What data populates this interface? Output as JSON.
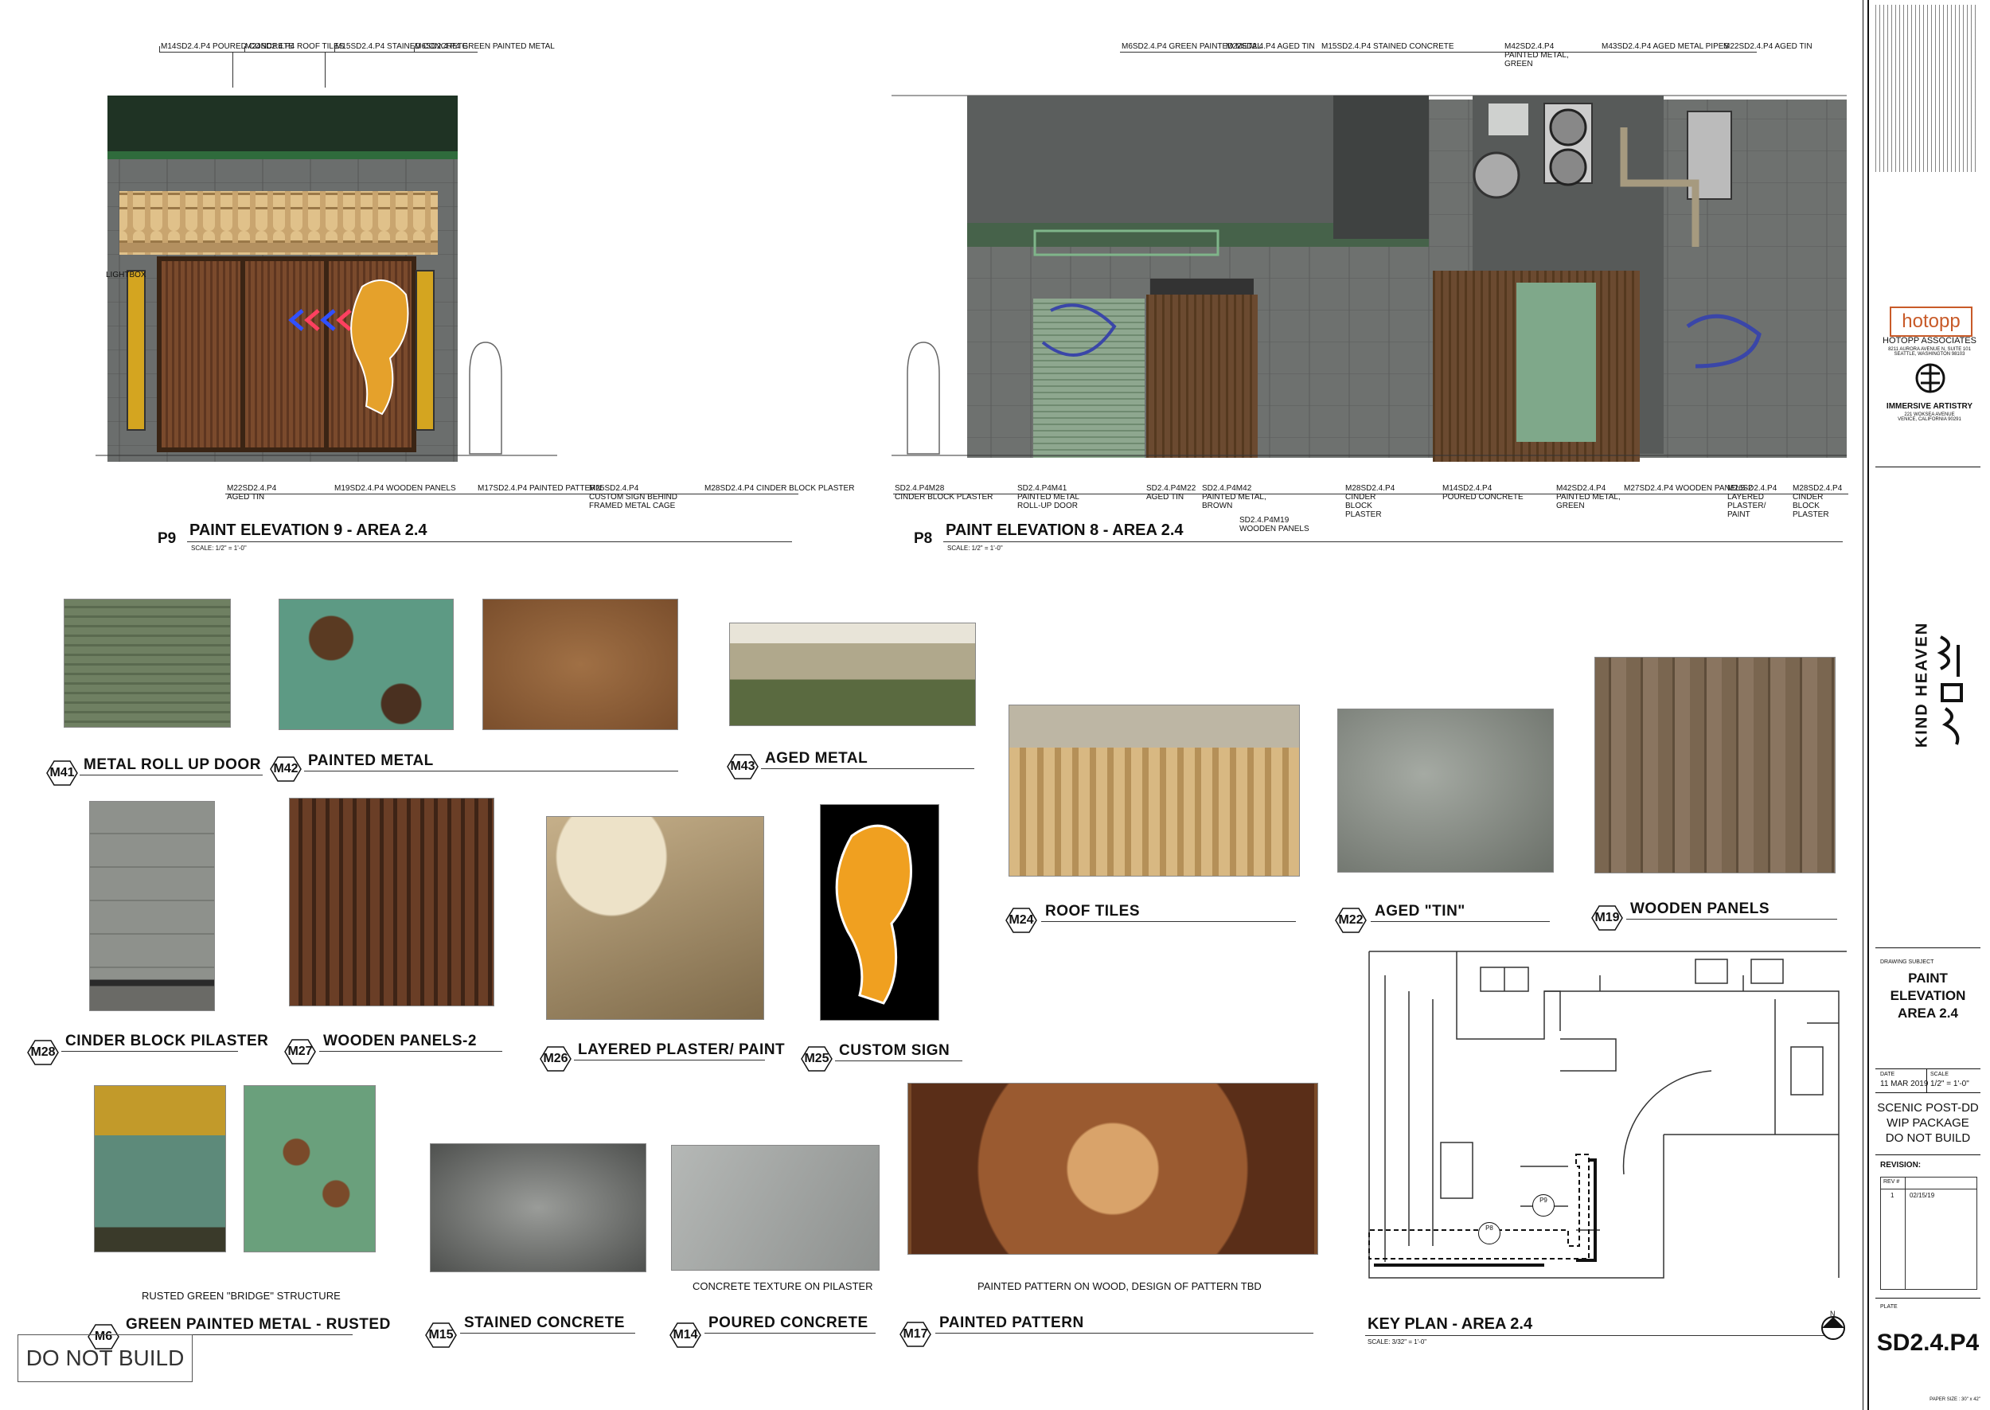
{
  "elevations": {
    "p9": {
      "code": "P9",
      "title": "PAINT ELEVATION 9 - AREA 2.4",
      "scale": "SCALE: 1/2\" = 1'-0\"",
      "lightbox": "LIGHTBOX",
      "top_tags": [
        {
          "code": "M14SD2.4.P4",
          "label": "POURED CONCRETE"
        },
        {
          "code": "M24SD2.4.P4",
          "label": "ROOF TILES"
        },
        {
          "code": "M15SD2.4.P4",
          "label": "STAINED CONCRETE"
        },
        {
          "code": "M6SD2.4.P4",
          "label": "GREEN PAINTED METAL"
        }
      ],
      "bottom_tags": [
        {
          "code": "M22SD2.4.P4",
          "label": "AGED TIN"
        },
        {
          "code": "M19SD2.4.P4",
          "label": "WOODEN PANELS"
        },
        {
          "code": "M17SD2.4.P4",
          "label": "PAINTED PATTERN"
        },
        {
          "code": "M25SD2.4.P4",
          "label": "CUSTOM SIGN BEHIND\nFRAMED METAL CAGE"
        },
        {
          "code": "M28SD2.4.P4",
          "label": "CINDER BLOCK PLASTER"
        }
      ]
    },
    "p8": {
      "code": "P8",
      "title": "PAINT ELEVATION 8 - AREA 2.4",
      "scale": "SCALE: 1/2\" = 1'-0\"",
      "top_tags": [
        {
          "code": "M6SD2.4.P4",
          "label": "GREEN PAINTED METAL"
        },
        {
          "code": "M22SD2.4.P4",
          "label": "AGED TIN"
        },
        {
          "code": "M15SD2.4.P4",
          "label": "STAINED CONCRETE"
        },
        {
          "code": "M42SD2.4.P4",
          "label": "PAINTED METAL,\nGREEN"
        },
        {
          "code": "M43SD2.4.P4",
          "label": "AGED METAL PIPES"
        },
        {
          "code": "M22SD2.4.P4",
          "label": "AGED TIN"
        }
      ],
      "bottom_tags": [
        {
          "code": "SD2.4.P4M28",
          "label": "CINDER BLOCK PLASTER"
        },
        {
          "code": "SD2.4.P4M41",
          "label": "PAINTED METAL\nROLL-UP DOOR"
        },
        {
          "code": "SD2.4.P4M22",
          "label": "AGED TIN"
        },
        {
          "code": "SD2.4.P4M42",
          "label": "PAINTED METAL,\nBROWN"
        },
        {
          "code": "SD2.4.P4M19",
          "label": "WOODEN PANELS"
        },
        {
          "code": "M28SD2.4.P4",
          "label": "CINDER\nBLOCK\nPLASTER"
        },
        {
          "code": "M14SD2.4.P4",
          "label": "POURED CONCRETE"
        },
        {
          "code": "M42SD2.4.P4",
          "label": "PAINTED METAL,\nGREEN"
        },
        {
          "code": "M27SD2.4.P4",
          "label": "WOODEN PANELS-2"
        },
        {
          "code": "M26SD2.4.P4",
          "label": "LAYERED\nPLASTER/\nPAINT"
        },
        {
          "code": "M28SD2.4.P4",
          "label": "CINDER\nBLOCK\nPLASTER"
        }
      ]
    }
  },
  "materials": [
    {
      "code": "M41",
      "label": "METAL ROLL UP DOOR"
    },
    {
      "code": "M42",
      "label": "PAINTED METAL"
    },
    {
      "code": "M43",
      "label": "AGED METAL"
    },
    {
      "code": "M24",
      "label": "ROOF TILES"
    },
    {
      "code": "M22",
      "label": "AGED \"TIN\""
    },
    {
      "code": "M19",
      "label": "WOODEN PANELS"
    },
    {
      "code": "M28",
      "label": "CINDER BLOCK PILASTER"
    },
    {
      "code": "M27",
      "label": "WOODEN PANELS-2"
    },
    {
      "code": "M26",
      "label": "LAYERED PLASTER/ PAINT"
    },
    {
      "code": "M25",
      "label": "CUSTOM SIGN"
    },
    {
      "code": "M6",
      "label": "GREEN PAINTED METAL - RUSTED"
    },
    {
      "code": "M15",
      "label": "STAINED CONCRETE"
    },
    {
      "code": "M14",
      "label": "POURED CONCRETE"
    },
    {
      "code": "M17",
      "label": "PAINTED PATTERN"
    }
  ],
  "captions": {
    "m6": "RUSTED GREEN \"BRIDGE\" STRUCTURE",
    "m14": "CONCRETE TEXTURE ON PILASTER",
    "m17": "PAINTED PATTERN ON WOOD, DESIGN OF PATTERN TBD"
  },
  "key_plan": {
    "title": "KEY PLAN - AREA 2.4",
    "scale": "SCALE: 3/32\" = 1'-0\"",
    "marker_p9": "P9",
    "marker_p8": "P8",
    "north": "N"
  },
  "do_not_build": "DO NOT BUILD",
  "title_block": {
    "company1": "hotopp",
    "company1_full": "HOTOPP ASSOCIATES",
    "company1_addr": "8211 AURORA AVENUE N, SUITE 101\nSEATTLE, WASHINGTON 98103",
    "company2": "IMMERSIVE ARTISTRY",
    "company2_addr": "221 WOKSEA AVENUE\nVENICE, CALIFORNIA 90291",
    "project": "KIND HEAVEN",
    "subject_label": "DRAWING SUBJECT",
    "subject": "PAINT\nELEVATION\nAREA 2.4",
    "date_label": "DATE",
    "date": "11 MAR 2019",
    "scale_label": "SCALE",
    "scale": "1/2\" = 1'-0\"",
    "package": "SCENIC POST-DD\nWIP PACKAGE\nDO NOT BUILD",
    "revision_label": "REVISION:",
    "rev_header": "REV #",
    "rev_number": "1",
    "rev_date": "02/15/19",
    "plate_label": "PLATE",
    "plate": "SD2.4.P4",
    "paper_size": "PAPER SIZE : 30\" x 42\""
  }
}
